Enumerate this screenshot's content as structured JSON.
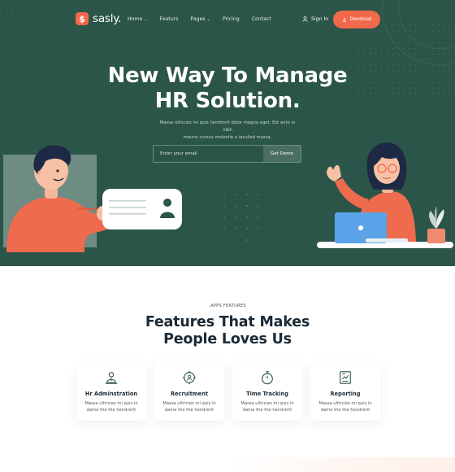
{
  "brand": {
    "logo_glyph": "$",
    "name": "sasly."
  },
  "nav": {
    "items": [
      {
        "label": "Home",
        "has_dropdown": true,
        "chevron": "⌄"
      },
      {
        "label": "Featurs",
        "has_dropdown": false,
        "chevron": ""
      },
      {
        "label": "Pages",
        "has_dropdown": true,
        "chevron": "⌄"
      },
      {
        "label": "Pricing",
        "has_dropdown": false,
        "chevron": ""
      },
      {
        "label": "Contact",
        "has_dropdown": false,
        "chevron": ""
      }
    ],
    "signin_label": "Sign In",
    "download_label": "Download"
  },
  "hero": {
    "title_line1": "New Way To Manage",
    "title_line2": "HR Solution.",
    "subtitle_line1": "Massa ultricies mi quis hendrerit dolor magna eget. Est ante in nibh",
    "subtitle_line2": "mauris cursus  molestie a iaculisd massa.",
    "email_placeholder": "Enter your email",
    "demo_label": "Get Demo"
  },
  "features": {
    "tag": ".APPS FEATURES",
    "title_line1": "Features That Makes",
    "title_line2": "People Loves Us",
    "cards": [
      {
        "title": "Hr Adminstration",
        "desc_line1": "Massa ultricies mi quis in",
        "desc_line2": "dame the the hendrerit",
        "icon": "hr-admin-icon"
      },
      {
        "title": "Recruitment",
        "desc_line1": "Massa ultricies mi quis in",
        "desc_line2": "dame the the hendrerit",
        "icon": "recruitment-target-icon"
      },
      {
        "title": "Time Tracking",
        "desc_line1": "Massa ultricies mi quis in",
        "desc_line2": "dame the the hendrerit",
        "icon": "stopwatch-icon"
      },
      {
        "title": "Reporting",
        "desc_line1": "Massa ultricies mi quis in",
        "desc_line2": "dame the the hendrerit",
        "icon": "report-chart-icon"
      }
    ]
  },
  "colors": {
    "hero_bg": "#2b5549",
    "accent": "#f2684a",
    "dark_text": "#1b2a35",
    "icon_teal": "#2b5549"
  }
}
